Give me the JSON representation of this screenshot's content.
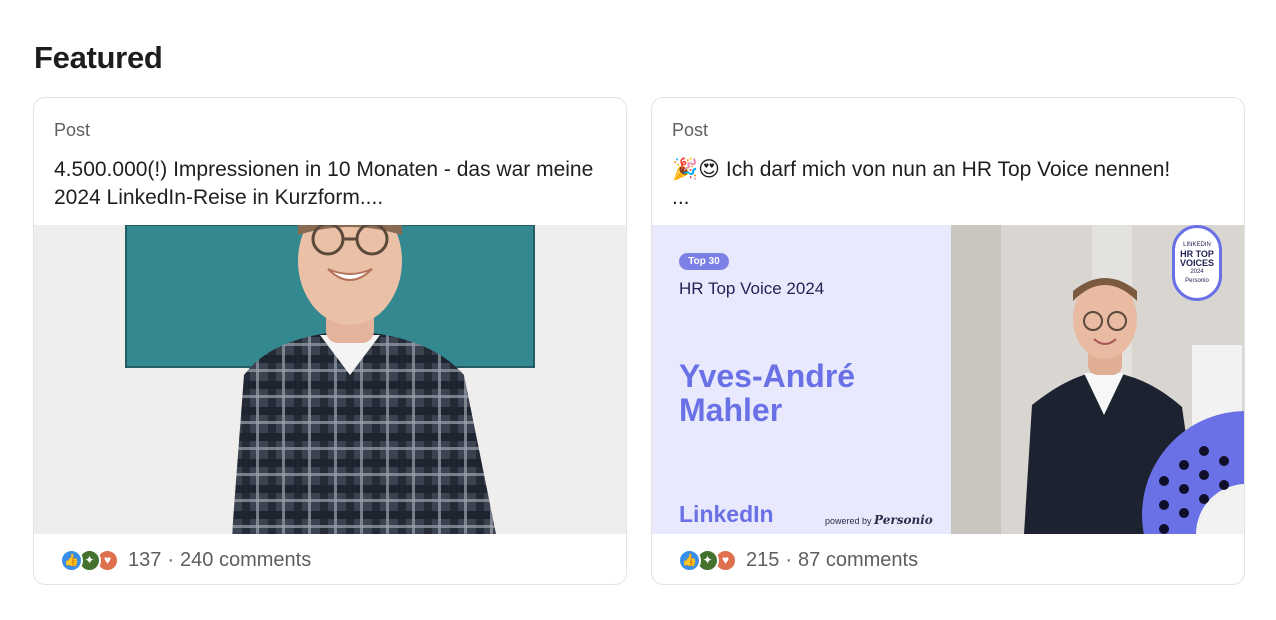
{
  "section": {
    "title": "Featured"
  },
  "cards": [
    {
      "type": "Post",
      "text": "4.500.000(!) Impressionen in 10 Monaten - das war meine 2024 LinkedIn-Reise in Kurzform....",
      "reactions": "137",
      "comments": "240 comments"
    },
    {
      "type": "Post",
      "text": "🎉😍 Ich darf mich von nun an HR Top Voice nennen!\n...",
      "reactions": "215",
      "comments": "87 comments",
      "banner": {
        "pill": "Top 30",
        "subtitle": "HR Top Voice 2024",
        "name": "Yves-André Mahler",
        "brand": "LinkedIn",
        "powered": "powered by",
        "powered_brand": "Personio",
        "badge_line1": "LINKEDIN",
        "badge_line2": "HR TOP",
        "badge_line3": "VOICES",
        "badge_line4": "2024",
        "badge_line5": "Personio"
      }
    }
  ],
  "icons": {
    "like": "like-reaction-icon",
    "celebrate": "celebrate-reaction-icon",
    "love": "love-reaction-icon"
  },
  "colors": {
    "card_border": "#e3e3e3",
    "like": "#378fe9",
    "celebrate": "#44712e",
    "love": "#df704d",
    "banner_bg": "#e8e9fd",
    "banner_accent": "#6a70e6"
  }
}
